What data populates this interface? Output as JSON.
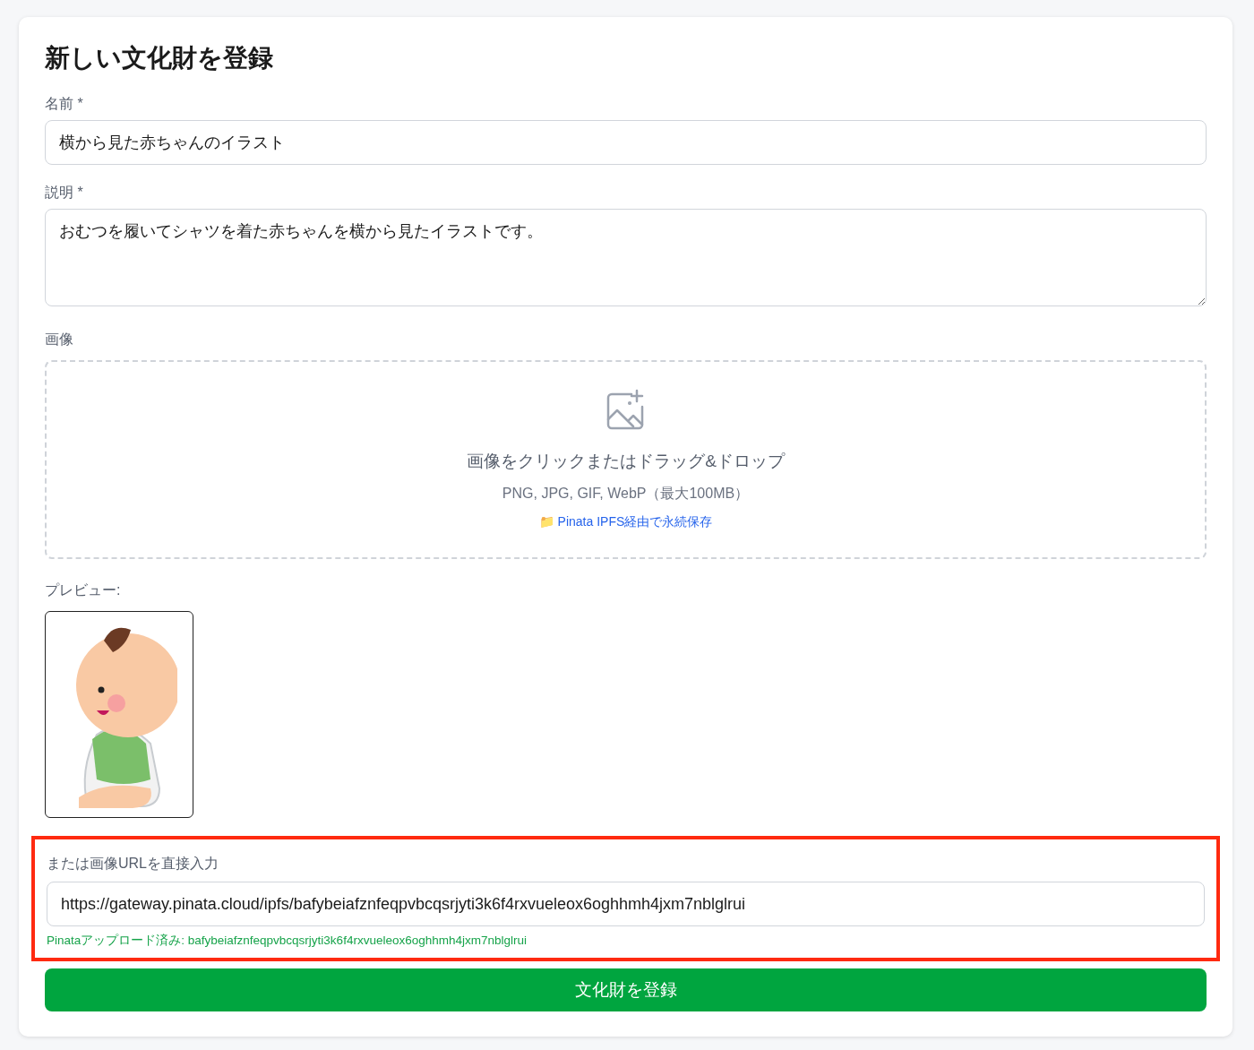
{
  "title": "新しい文化財を登録",
  "name_field": {
    "label": "名前 *",
    "value": "横から見た赤ちゃんのイラスト"
  },
  "description_field": {
    "label": "説明 *",
    "value": "おむつを履いてシャツを着た赤ちゃんを横から見たイラストです。"
  },
  "image_upload": {
    "label": "画像",
    "prompt": "画像をクリックまたはドラッグ&ドロップ",
    "formats": "PNG, JPG, GIF, WebP（最大100MB）",
    "storage_note": "📁 Pinata IPFS経由で永続保存"
  },
  "preview": {
    "label": "プレビュー:"
  },
  "url_section": {
    "highlighted": true,
    "label": "または画像URLを直接入力",
    "value": "https://gateway.pinata.cloud/ipfs/bafybeiafznfeqpvbcqsrjyti3k6f4rxvueleox6oghhmh4jxm7nblglrui",
    "status": "Pinataアップロード済み: bafybeiafznfeqpvbcqsrjyti3k6f4rxvueleox6oghhmh4jxm7nblglrui"
  },
  "submit_button": "文化財を登録"
}
